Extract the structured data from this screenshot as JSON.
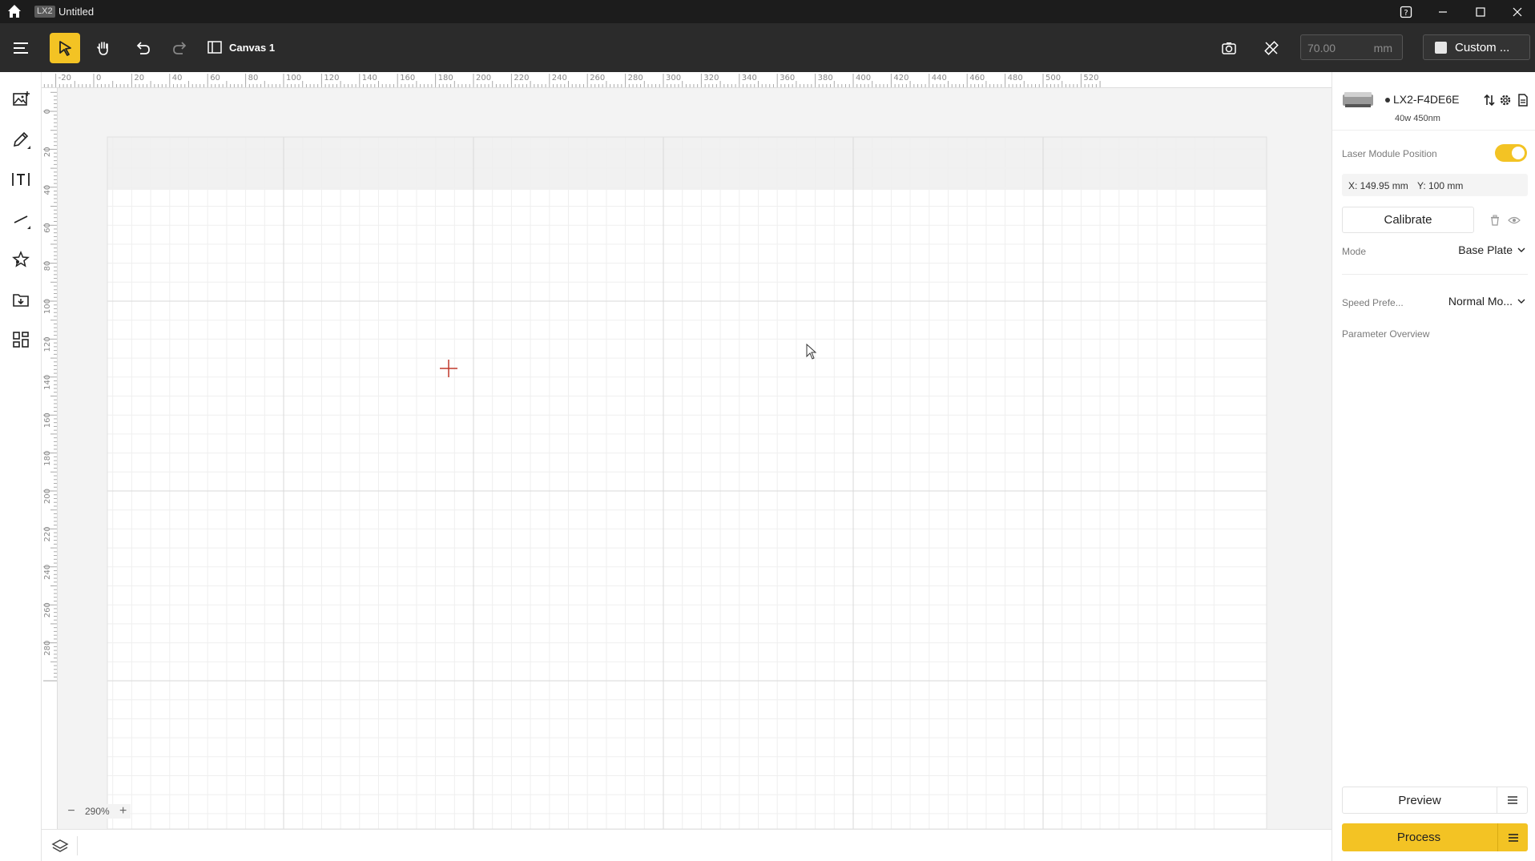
{
  "titlebar": {
    "app_badge": "LX2",
    "document_title": "Untitled"
  },
  "toolbar": {
    "canvas_tab_label": "Canvas 1",
    "size_value": "70.00",
    "size_unit": "mm",
    "material_label": "Custom ..."
  },
  "rulers": {
    "top_labels": [
      "-20",
      "0",
      "20",
      "40",
      "60",
      "80",
      "100",
      "120",
      "140",
      "160",
      "180",
      "200",
      "220",
      "240",
      "260",
      "280",
      "300",
      "320",
      "340",
      "360",
      "380",
      "400",
      "420",
      "440",
      "460",
      "480",
      "500",
      "520"
    ],
    "left_labels": [
      "0",
      "20",
      "40",
      "60",
      "80",
      "100",
      "120",
      "140",
      "160",
      "180",
      "200",
      "220",
      "240",
      "260",
      "280"
    ]
  },
  "zoom": {
    "level": "290%"
  },
  "device": {
    "name": "LX2-F4DE6E",
    "spec": "40w 450nm"
  },
  "panel": {
    "laser_module_label": "Laser Module Position",
    "x_readout": "X: 149.95 mm",
    "y_readout": "Y: 100 mm",
    "calibrate_label": "Calibrate",
    "mode_label": "Mode",
    "mode_value": "Base Plate",
    "speed_label": "Speed Prefe...",
    "speed_value": "Normal Mo...",
    "parameter_overview_label": "Parameter Overview",
    "preview_label": "Preview",
    "process_label": "Process"
  },
  "colors": {
    "accent": "#f3c324",
    "toolbar_bg": "#2b2b2b",
    "titlebar_bg": "#1c1c1c",
    "origin_marker": "#c0392b"
  }
}
